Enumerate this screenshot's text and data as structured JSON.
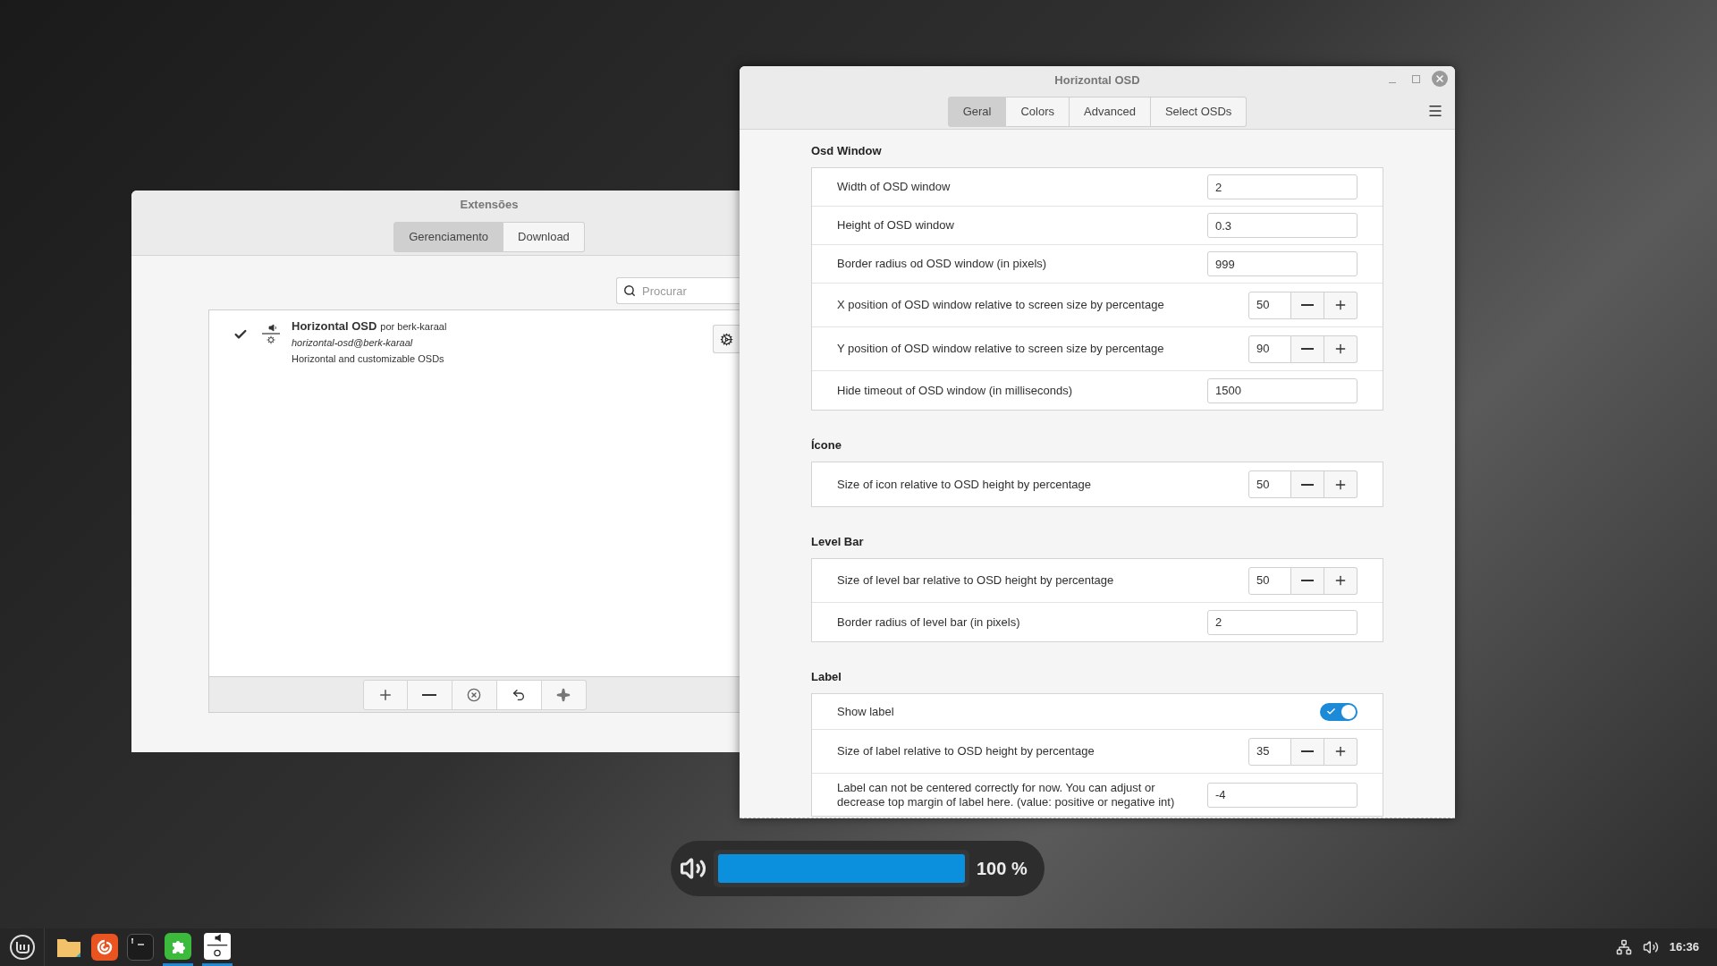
{
  "extensions_window": {
    "title": "Extensões",
    "tabs": [
      {
        "label": "Gerenciamento",
        "selected": true
      },
      {
        "label": "Download",
        "selected": false
      }
    ],
    "search": {
      "placeholder": "Procurar"
    },
    "extensions": [
      {
        "name": "Horizontal OSD",
        "author": "por berk-karaal",
        "uuid": "horizontal-osd@berk-karaal",
        "description": "Horizontal and customizable OSDs",
        "enabled": true
      }
    ]
  },
  "settings_window": {
    "title": "Horizontal OSD",
    "tabs": [
      {
        "label": "Geral",
        "selected": true
      },
      {
        "label": "Colors",
        "selected": false
      },
      {
        "label": "Advanced",
        "selected": false
      },
      {
        "label": "Select OSDs",
        "selected": false
      }
    ],
    "sections": [
      {
        "title": "Osd Window",
        "rows": [
          {
            "kind": "entry",
            "label": "Width of OSD window",
            "value": "2"
          },
          {
            "kind": "entry",
            "label": "Height of OSD window",
            "value": "0.3"
          },
          {
            "kind": "entry",
            "label": "Border radius od OSD window (in pixels)",
            "value": "999"
          },
          {
            "kind": "spin",
            "label": "X position of OSD window relative to screen size by percentage",
            "value": "50"
          },
          {
            "kind": "spin",
            "label": "Y position of OSD window relative to screen size by percentage",
            "value": "90"
          },
          {
            "kind": "entry",
            "label": "Hide timeout of OSD window (in milliseconds)",
            "value": "1500"
          }
        ]
      },
      {
        "title": "Ícone",
        "rows": [
          {
            "kind": "spin",
            "label": "Size of icon relative to OSD height by percentage",
            "value": "50"
          }
        ]
      },
      {
        "title": "Level Bar",
        "rows": [
          {
            "kind": "spin",
            "label": "Size of level bar relative to OSD height by percentage",
            "value": "50"
          },
          {
            "kind": "entry",
            "label": "Border radius of level bar (in pixels)",
            "value": "2"
          }
        ]
      },
      {
        "title": "Label",
        "rows": [
          {
            "kind": "switch",
            "label": "Show label",
            "on": true
          },
          {
            "kind": "spin",
            "label": "Size of label relative to OSD height by percentage",
            "value": "35"
          },
          {
            "kind": "entry",
            "label": "Label can not be centered correctly for now. You can adjust or decrease top margin of label here. (value: positive or negative int)",
            "value": "-4"
          }
        ]
      }
    ]
  },
  "osd": {
    "level": 1,
    "reading": "100 %"
  },
  "taskbar": {
    "clock": "16:36"
  }
}
